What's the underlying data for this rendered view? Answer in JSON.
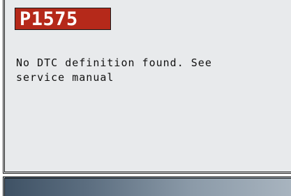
{
  "screen": {
    "dtc_code": "P1575",
    "message": "No DTC definition found. See\nservice manual"
  },
  "colors": {
    "code_background": "#b5291a",
    "display_background": "#e8eaec",
    "status_bar_gradient_start": "#3f5265",
    "status_bar_gradient_end": "#a8b4bf"
  }
}
